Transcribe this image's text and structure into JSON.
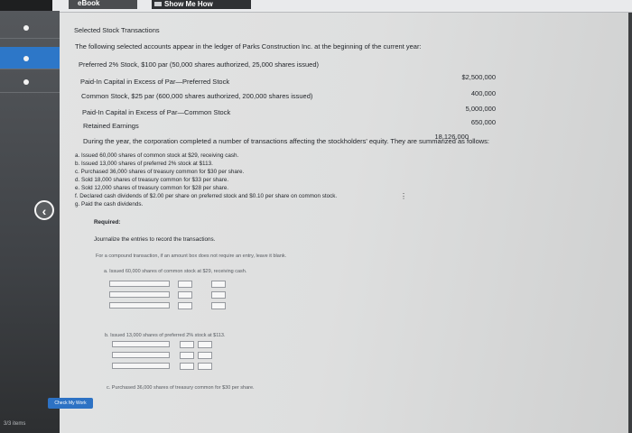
{
  "toolbar": {
    "ebook_label": "eBook",
    "show_label": "Show Me How"
  },
  "sidebar": {
    "footer": "3/3 items"
  },
  "page": {
    "title": "Selected Stock Transactions",
    "intro": "The following selected accounts appear in the ledger of Parks Construction Inc. at the beginning of the current year:",
    "accounts": [
      {
        "label": "Preferred 2% Stock, $100 par (50,000 shares authorized, 25,000 shares issued)",
        "value": "$2,500,000"
      },
      {
        "label": "Paid-In Capital in Excess of Par—Preferred Stock",
        "value": "400,000"
      },
      {
        "label": "Common Stock, $25 par (600,000 shares authorized, 200,000 shares issued)",
        "value": "5,000,000"
      },
      {
        "label": "Paid-In Capital in Excess of Par—Common Stock",
        "value": "650,000"
      },
      {
        "label": "Retained Earnings",
        "value": "18,126,000"
      }
    ],
    "during": "During the year, the corporation completed a number of transactions affecting the stockholders' equity. They are summarized as follows:",
    "transactions": [
      "a. Issued 60,000 shares of common stock at $29, receiving cash.",
      "b. Issued 13,000 shares of preferred 2% stock at $113.",
      "c. Purchased 36,000 shares of treasury common for $30 per share.",
      "d. Sold 18,000 shares of treasury common for $33 per share.",
      "e. Sold 12,000 shares of treasury common for $28 per share.",
      "f. Declared cash dividends of $2.00 per share on preferred stock and $0.10 per share on common stock.",
      "g. Paid the cash dividends."
    ],
    "required_label": "Required:",
    "required_text": "Journalize the entries to record the transactions.",
    "instruction": "For a compound transaction, if an amount box does not require an entry, leave it blank.",
    "part_a": "a. Issued 60,000 shares of common stock at $29, receiving cash.",
    "part_b": "b. Issued 13,000 shares of preferred 2% stock at $113.",
    "part_c": "c. Purchased 36,000 shares of treasury common for $30 per share.",
    "check_label": "Check My Work"
  }
}
